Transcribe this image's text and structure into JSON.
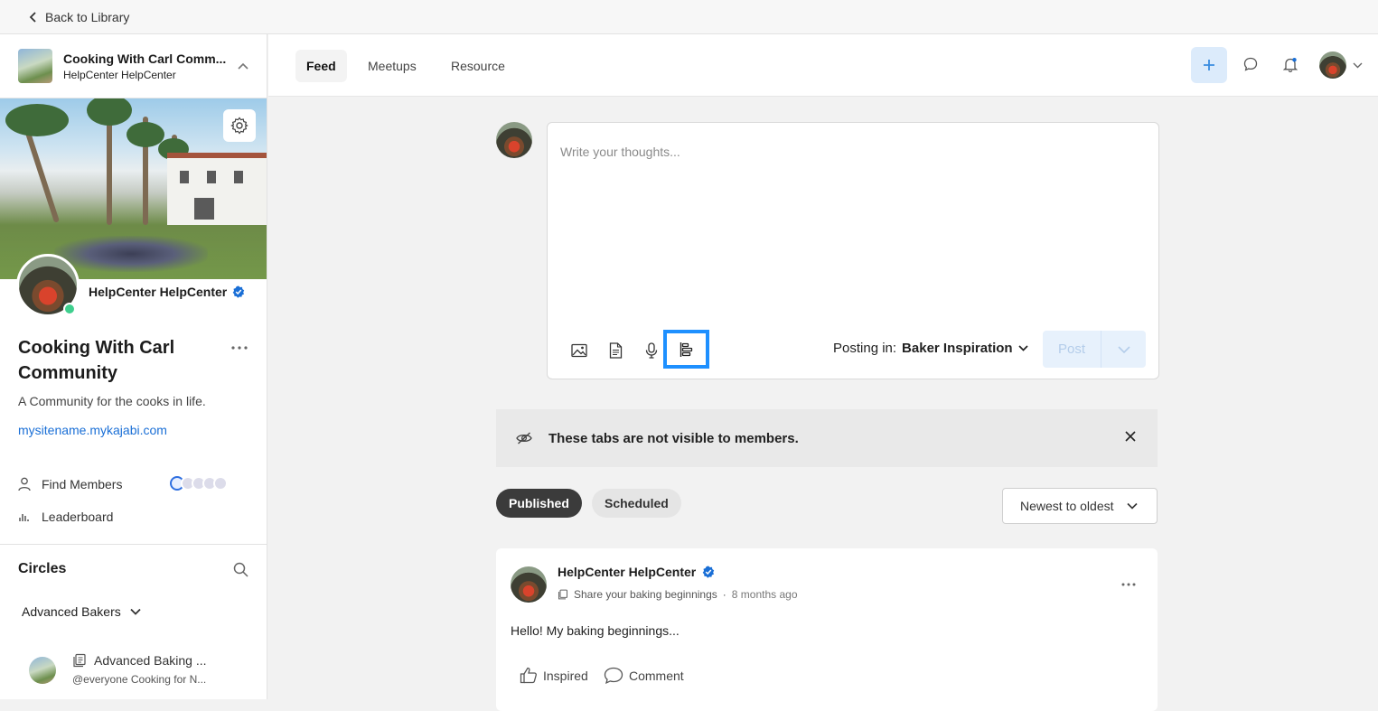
{
  "topbar": {
    "back_label": "Back to Library"
  },
  "community": {
    "title": "Cooking With Carl Comm...",
    "subtitle": "HelpCenter HelpCenter",
    "owner_name": "HelpCenter HelpCenter",
    "name": "Cooking With Carl Community",
    "tagline": "A Community for the cooks in life.",
    "site_url": "mysitename.mykajabi.com"
  },
  "sidebar": {
    "find_members": "Find Members",
    "leaderboard": "Leaderboard",
    "circles_title": "Circles",
    "circle_select": "Advanced Bakers",
    "circle_item": {
      "title": "Advanced Baking ...",
      "subtitle": "@everyone Cooking for N..."
    }
  },
  "nav": {
    "tabs": [
      "Feed",
      "Meetups",
      "Resource"
    ],
    "active": "Feed"
  },
  "composer": {
    "placeholder": "Write your thoughts...",
    "posting_in_label": "Posting in:",
    "posting_in_value": "Baker Inspiration",
    "post_label": "Post"
  },
  "notice": {
    "text": "These tabs are not visible to members."
  },
  "filters": {
    "published": "Published",
    "scheduled": "Scheduled",
    "sort": "Newest to oldest"
  },
  "post": {
    "author": "HelpCenter HelpCenter",
    "topic": "Share your baking beginnings",
    "separator": "·",
    "time": "8 months ago",
    "body": "Hello! My baking beginnings...",
    "reaction": "Inspired",
    "comment": "Comment"
  },
  "colors": {
    "accent": "#1a6fd6",
    "highlight": "#1e90ff",
    "online": "#3fcf8e",
    "verified": "#1a6fd6"
  }
}
